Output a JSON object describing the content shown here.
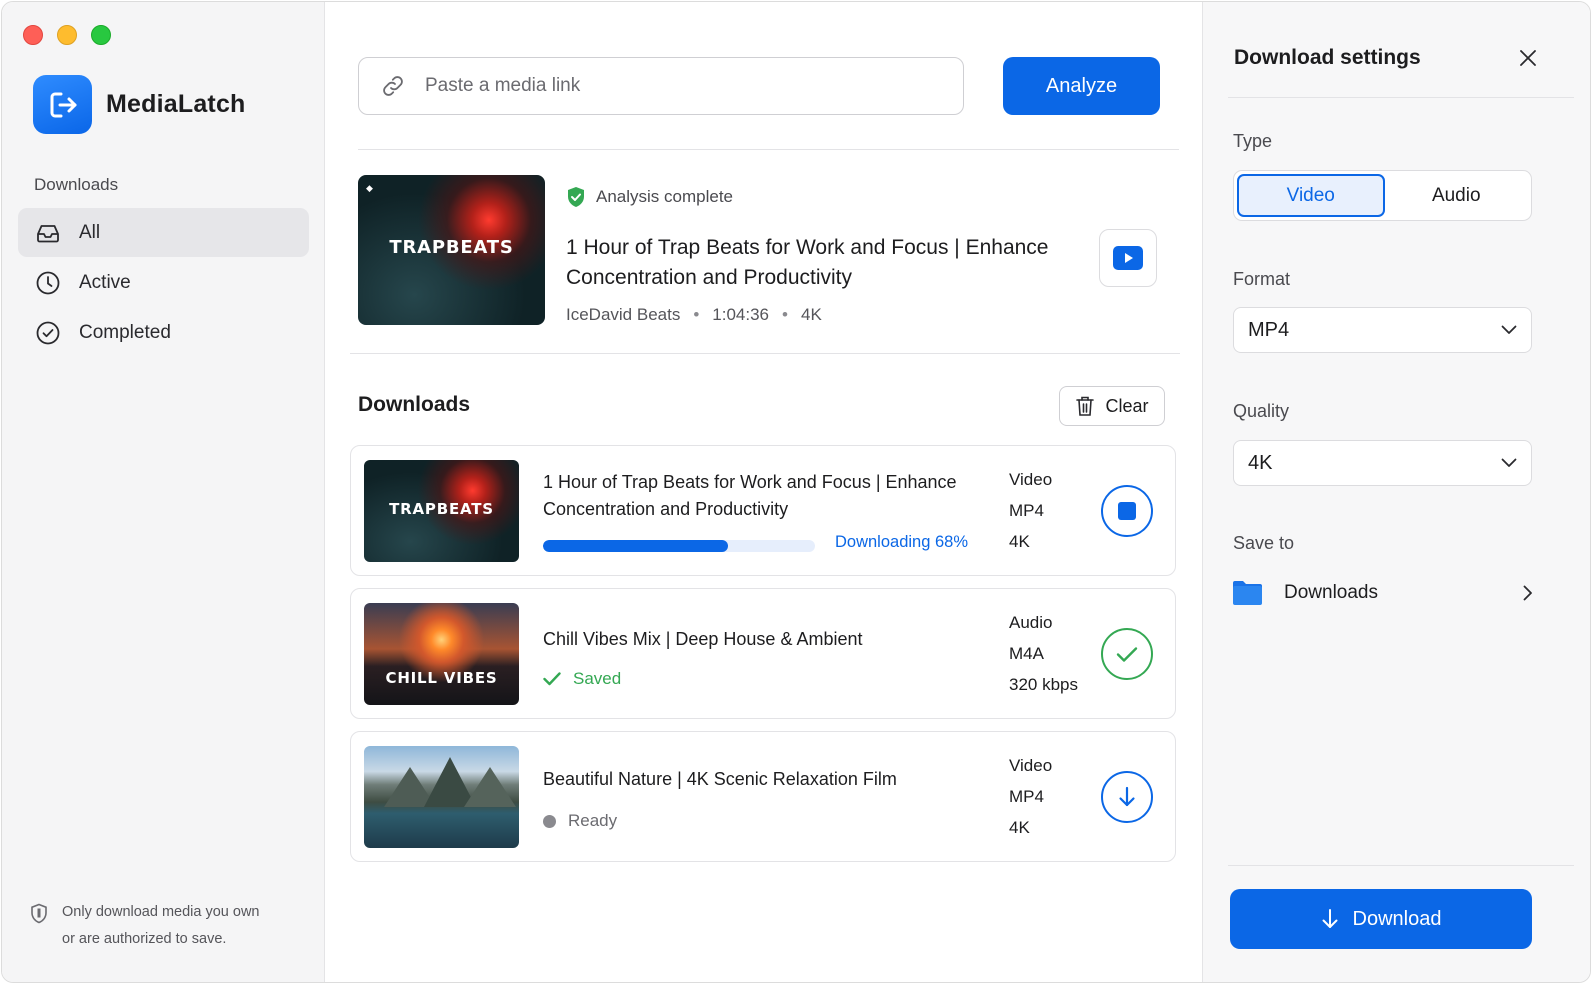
{
  "app": {
    "name": "MediaLatch"
  },
  "sidebar": {
    "section_label": "Downloads",
    "items": [
      {
        "label": "All",
        "icon": "inbox-icon",
        "active": true
      },
      {
        "label": "Active",
        "icon": "clock-icon",
        "active": false
      },
      {
        "label": "Completed",
        "icon": "check-circle-icon",
        "active": false
      }
    ],
    "footer_note_line1": "Only download media you own",
    "footer_note_line2": "or are authorized to save."
  },
  "search": {
    "placeholder": "Paste a media link",
    "value": ""
  },
  "analyze_label": "Analyze",
  "preview": {
    "thumb_label": "TRAPBEATS",
    "status": "Analysis complete",
    "title": "1 Hour of Trap Beats for Work and Focus | Enhance Concentration and Productivity",
    "channel": "IceDavid Beats",
    "duration": "1:04:36",
    "quality": "4K"
  },
  "downloads": {
    "heading": "Downloads",
    "clear_label": "Clear",
    "items": [
      {
        "thumb_label": "TRAPBEATS",
        "title": "1 Hour of Trap Beats for Work and Focus | Enhance Concentration and Productivity",
        "type": "Video",
        "format": "MP4",
        "quality": "4K",
        "status": "Downloading 68%",
        "progress": 0.68
      },
      {
        "thumb_label": "CHILL VIBES",
        "title": "Chill Vibes Mix | Deep House & Ambient",
        "type": "Audio",
        "format": "M4A",
        "quality": "320 kbps",
        "status": "Saved"
      },
      {
        "thumb_label": "",
        "title": "Beautiful Nature | 4K Scenic Relaxation Film",
        "type": "Video",
        "format": "MP4",
        "quality": "4K",
        "status": "Ready"
      }
    ]
  },
  "settings": {
    "title": "Download settings",
    "type_label": "Type",
    "type_options": [
      "Video",
      "Audio"
    ],
    "type_selected": "Video",
    "format_label": "Format",
    "format_value": "MP4",
    "quality_label": "Quality",
    "quality_value": "4K",
    "save_to_label": "Save to",
    "save_to_value": "Downloads",
    "download_label": "Download"
  },
  "colors": {
    "accent": "#0b67e6",
    "success": "#34a853",
    "muted": "#8a8a8f"
  }
}
